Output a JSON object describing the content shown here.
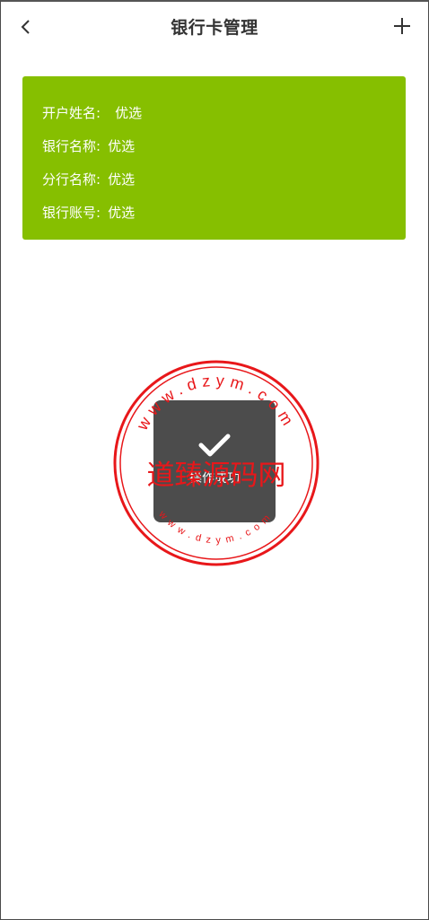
{
  "header": {
    "back_icon": "chevron-left-icon",
    "title": "银行卡管理",
    "add_icon": "plus-icon"
  },
  "card": {
    "background": "#86bf00",
    "rows": [
      {
        "label": "开户姓名:",
        "value": "优选"
      },
      {
        "label": "银行名称:",
        "value": "优选"
      },
      {
        "label": "分行名称:",
        "value": "优选"
      },
      {
        "label": "银行账号:",
        "value": "优选"
      }
    ]
  },
  "toast": {
    "icon": "check-icon",
    "message": "操作成功"
  },
  "watermark": {
    "text": "道臻源码网",
    "url_top": "www.dzym.com",
    "url_bottom": "www.dzym.com",
    "color": "#e8171a"
  }
}
